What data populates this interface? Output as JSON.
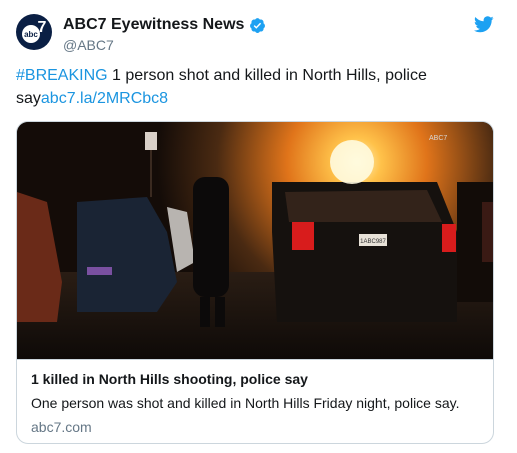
{
  "tweet": {
    "display_name": "ABC7 Eyewitness News",
    "handle": "@ABC7",
    "hashtag": "#BREAKING",
    "text": " 1 person shot and killed in North Hills, police say",
    "link": "abc7.la/2MRCbc8"
  },
  "avatar": {
    "logo_text": "abc",
    "logo_number": "7"
  },
  "card": {
    "title": "1 killed in North Hills shooting, police say",
    "description": "One person was shot and killed in North Hills Friday night, police say.",
    "domain": "abc7.com",
    "image_watermark": "ABC7",
    "plate_text": "1ABC987"
  },
  "icons": {
    "verified": "verified-badge-icon",
    "twitter": "twitter-bird-icon"
  },
  "colors": {
    "link": "#1b95e0",
    "verified": "#1da1f2",
    "twitter_bird": "#1da1f2",
    "muted": "#657786",
    "border": "#ccd6dd"
  }
}
